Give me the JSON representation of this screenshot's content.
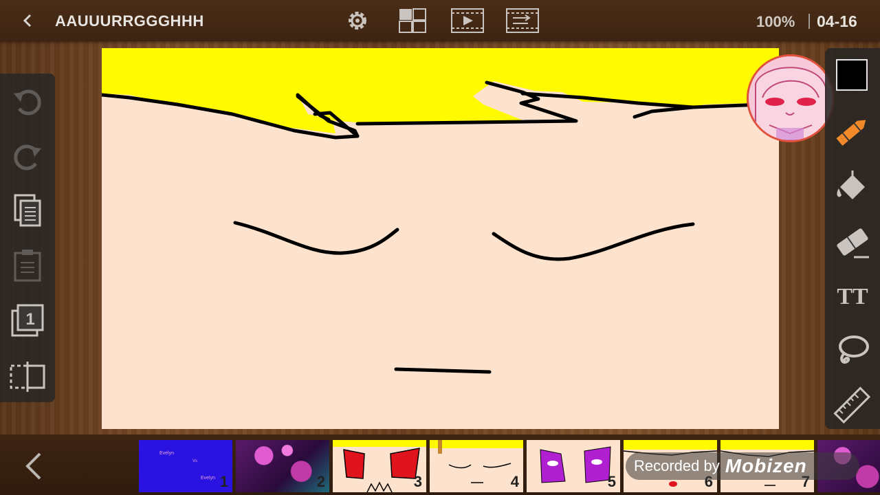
{
  "header": {
    "title": "AAUUURRGGGHHH",
    "zoom": "100%",
    "frame": "04-16",
    "icons": [
      "back-icon",
      "settings-gear-icon",
      "layers-grid-icon",
      "play-animation-icon",
      "frame-export-icon"
    ]
  },
  "left_toolbar": {
    "icons": [
      "undo-icon",
      "redo-icon",
      "copy-icon",
      "paste-icon",
      "layer-icon",
      "frame-split-icon"
    ],
    "layer_number": "1"
  },
  "right_toolbar": {
    "current_color": "#000000",
    "icons": [
      "pencil-icon",
      "fill-bucket-icon",
      "eraser-icon",
      "text-icon",
      "lasso-icon",
      "ruler-icon"
    ],
    "text_tool_label": "TT"
  },
  "timeline": {
    "frames": [
      {
        "number": "1",
        "style": "blue"
      },
      {
        "number": "2",
        "style": "hearts"
      },
      {
        "number": "3",
        "style": "red-eyes"
      },
      {
        "number": "4",
        "style": "closed-eyes"
      },
      {
        "number": "5",
        "style": "purple-eyes"
      },
      {
        "number": "6",
        "style": "hair-face"
      },
      {
        "number": "7",
        "style": "hair-face"
      }
    ],
    "frame1_texts": [
      "Evelyn",
      "Vs",
      "Evelyn"
    ]
  },
  "watermark": {
    "text": "Recorded by",
    "logo": "Mobizen"
  },
  "colors": {
    "accent": "#f28a2a",
    "skin": "#fde3cd",
    "hair": "#fffa00"
  }
}
